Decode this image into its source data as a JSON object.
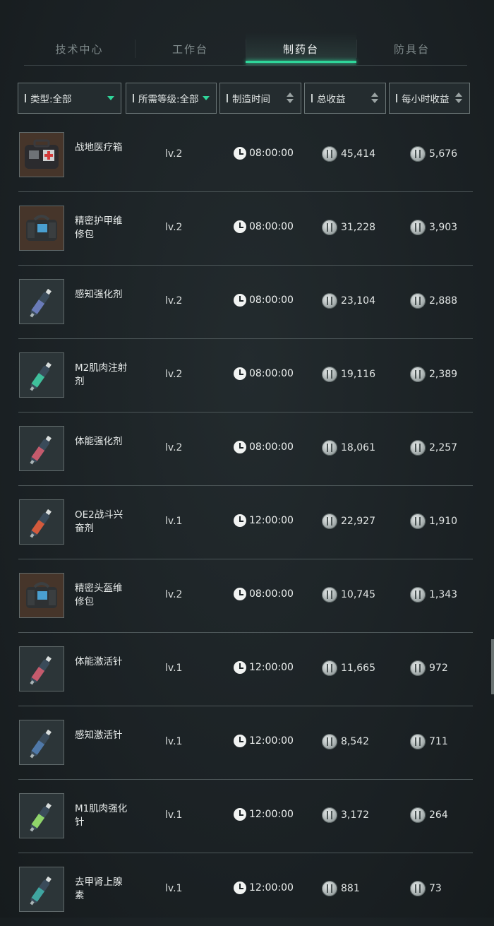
{
  "tabs": [
    {
      "label": "技术中心",
      "active": false
    },
    {
      "label": "工作台",
      "active": false
    },
    {
      "label": "制药台",
      "active": true
    },
    {
      "label": "防具台",
      "active": false
    }
  ],
  "filters": {
    "type": "类型:全部",
    "level": "所需等级:全部",
    "time": "制造时间",
    "total": "总收益",
    "hourly": "每小时收益"
  },
  "colors": {
    "accent": "#2fd69a",
    "background": "#1c2326"
  },
  "items": [
    {
      "name": "战地医疗箱",
      "level": "lv.2",
      "time": "08:00:00",
      "total": "45,414",
      "hourly": "5,676",
      "icon": "medkit-icon"
    },
    {
      "name": "精密护甲维修包",
      "level": "lv.2",
      "time": "08:00:00",
      "total": "31,228",
      "hourly": "3,903",
      "icon": "repair-bag-icon"
    },
    {
      "name": "感知强化剂",
      "level": "lv.2",
      "time": "08:00:00",
      "total": "23,104",
      "hourly": "2,888",
      "icon": "injector-icon"
    },
    {
      "name": "M2肌肉注射剂",
      "level": "lv.2",
      "time": "08:00:00",
      "total": "19,116",
      "hourly": "2,389",
      "icon": "injector-icon"
    },
    {
      "name": "体能强化剂",
      "level": "lv.2",
      "time": "08:00:00",
      "total": "18,061",
      "hourly": "2,257",
      "icon": "injector-icon"
    },
    {
      "name": "OE2战斗兴奋剂",
      "level": "lv.1",
      "time": "12:00:00",
      "total": "22,927",
      "hourly": "1,910",
      "icon": "injector-icon"
    },
    {
      "name": "精密头盔维修包",
      "level": "lv.2",
      "time": "08:00:00",
      "total": "10,745",
      "hourly": "1,343",
      "icon": "repair-bag-icon"
    },
    {
      "name": "体能激活针",
      "level": "lv.1",
      "time": "12:00:00",
      "total": "11,665",
      "hourly": "972",
      "icon": "injector-icon"
    },
    {
      "name": "感知激活针",
      "level": "lv.1",
      "time": "12:00:00",
      "total": "8,542",
      "hourly": "711",
      "icon": "injector-icon"
    },
    {
      "name": "M1肌肉强化针",
      "level": "lv.1",
      "time": "12:00:00",
      "total": "3,172",
      "hourly": "264",
      "icon": "injector-icon"
    },
    {
      "name": "去甲肾上腺素",
      "level": "lv.1",
      "time": "12:00:00",
      "total": "881",
      "hourly": "73",
      "icon": "injector-icon"
    }
  ]
}
